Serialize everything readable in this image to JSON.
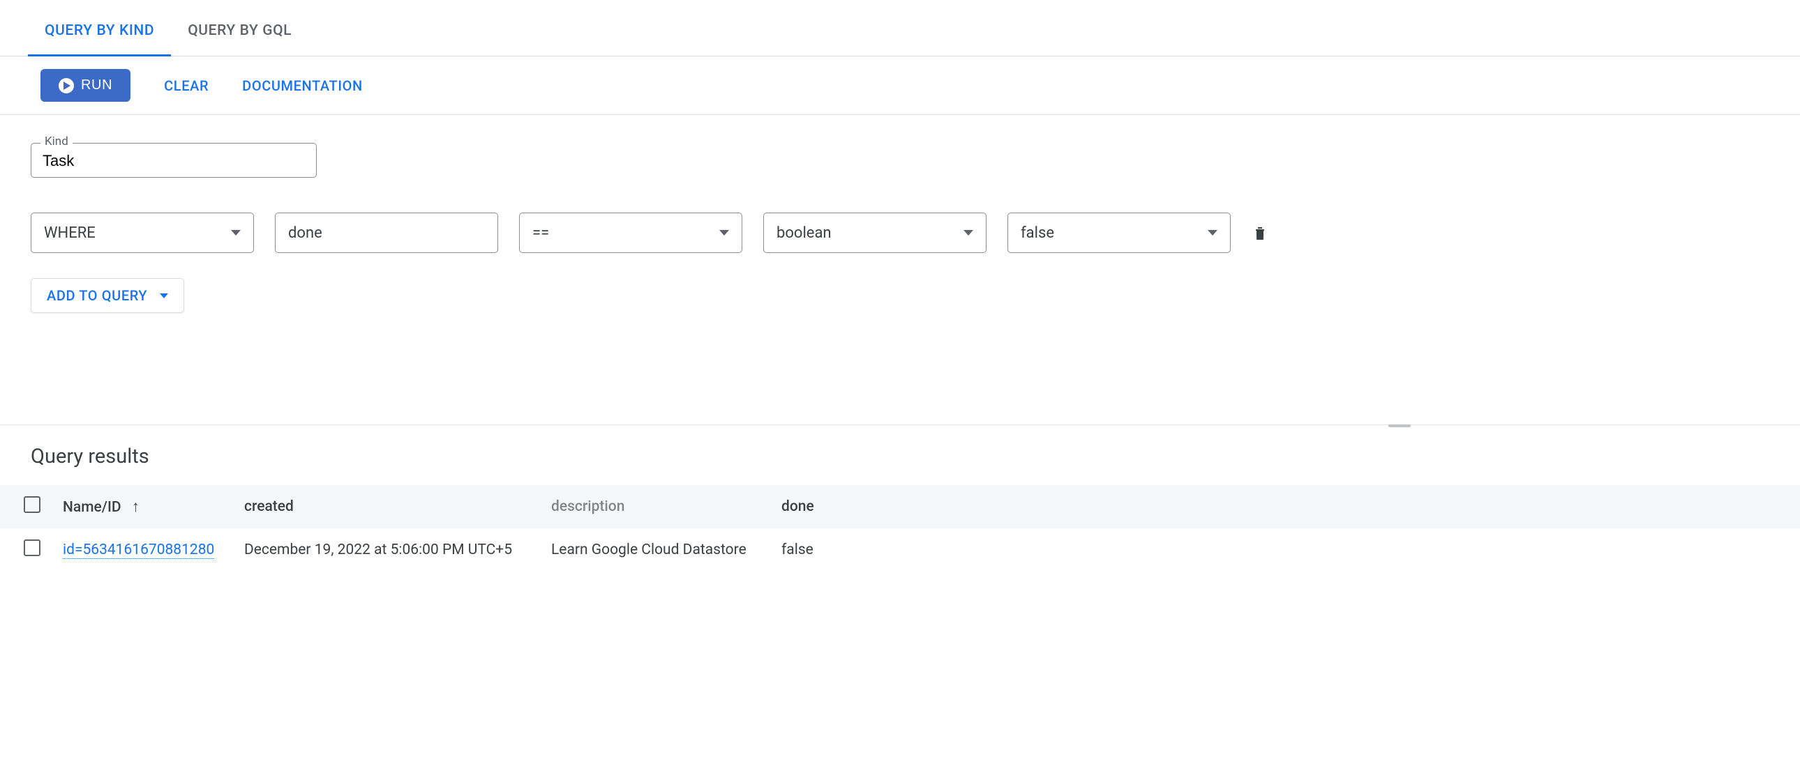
{
  "tabs": {
    "kind": "QUERY BY KIND",
    "gql": "QUERY BY GQL"
  },
  "actions": {
    "run": "RUN",
    "clear": "CLEAR",
    "docs": "DOCUMENTATION"
  },
  "kind": {
    "label": "Kind",
    "value": "Task"
  },
  "filter": {
    "clause": "WHERE",
    "property": "done",
    "operator": "==",
    "type": "boolean",
    "value": "false"
  },
  "add_to_query": "ADD TO QUERY",
  "results": {
    "title": "Query results",
    "columns": {
      "name": "Name/ID",
      "created": "created",
      "desc": "description",
      "done": "done"
    },
    "rows": [
      {
        "id": "id=5634161670881280",
        "created": "December 19, 2022 at 5:06:00 PM UTC+5",
        "desc": "Learn Google Cloud Datastore",
        "done": "false"
      }
    ]
  }
}
